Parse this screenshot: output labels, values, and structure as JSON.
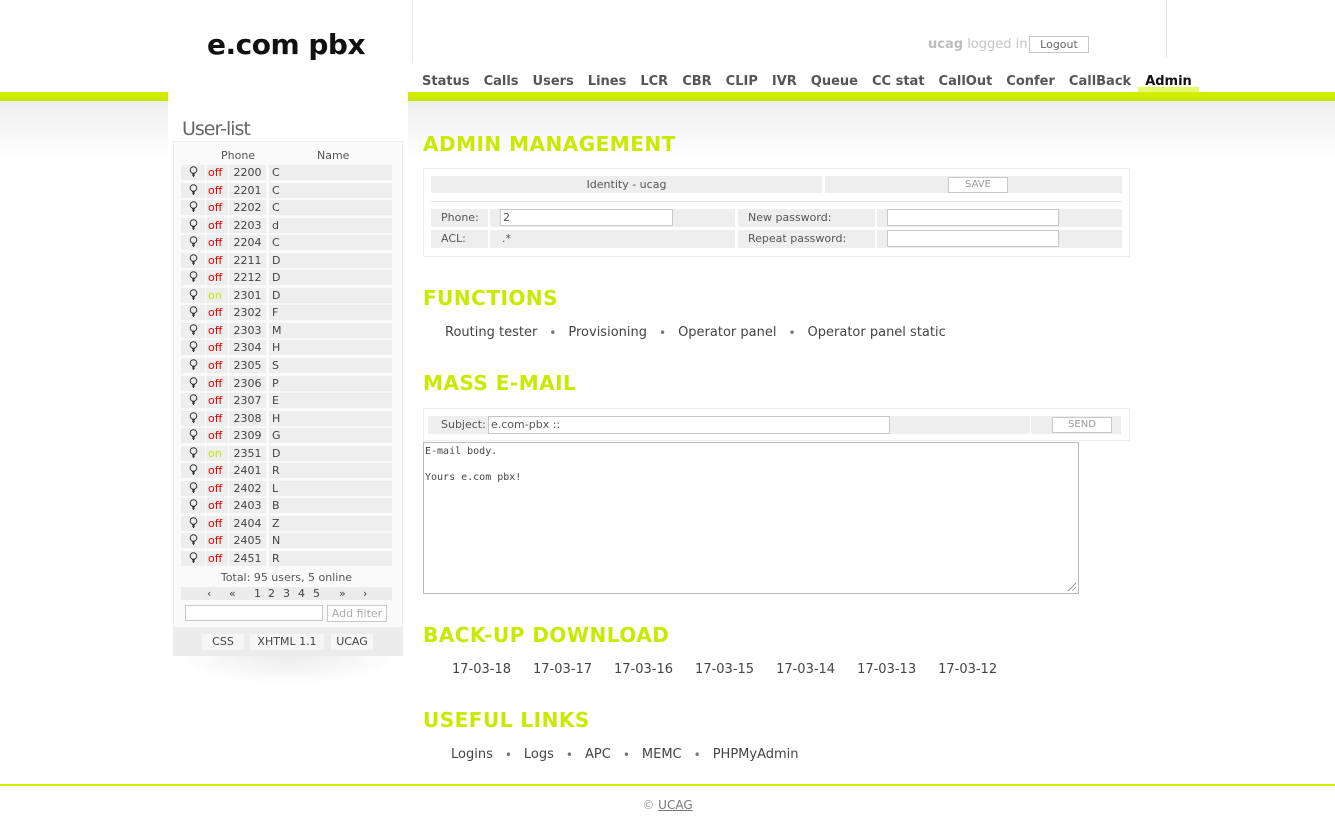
{
  "header": {
    "logo": "e.com pbx",
    "user": "ucag",
    "logged_in_text": "logged in",
    "logout_label": "Logout"
  },
  "nav": {
    "items": [
      "Status",
      "Calls",
      "Users",
      "Lines",
      "LCR",
      "CBR",
      "CLIP",
      "IVR",
      "Queue",
      "CC stat",
      "CallOut",
      "Confer",
      "CallBack",
      "Admin"
    ],
    "active": "Admin"
  },
  "sidebar": {
    "title": "User-list",
    "col_phone": "Phone",
    "col_name": "Name",
    "users": [
      {
        "state": "off",
        "phone": "2200",
        "name": "C"
      },
      {
        "state": "off",
        "phone": "2201",
        "name": "C"
      },
      {
        "state": "off",
        "phone": "2202",
        "name": "C"
      },
      {
        "state": "off",
        "phone": "2203",
        "name": "d"
      },
      {
        "state": "off",
        "phone": "2204",
        "name": "C"
      },
      {
        "state": "off",
        "phone": "2211",
        "name": "D"
      },
      {
        "state": "off",
        "phone": "2212",
        "name": "D"
      },
      {
        "state": "on",
        "phone": "2301",
        "name": "D"
      },
      {
        "state": "off",
        "phone": "2302",
        "name": "F"
      },
      {
        "state": "off",
        "phone": "2303",
        "name": "M"
      },
      {
        "state": "off",
        "phone": "2304",
        "name": "H"
      },
      {
        "state": "off",
        "phone": "2305",
        "name": "S"
      },
      {
        "state": "off",
        "phone": "2306",
        "name": "P"
      },
      {
        "state": "off",
        "phone": "2307",
        "name": "E"
      },
      {
        "state": "off",
        "phone": "2308",
        "name": "H"
      },
      {
        "state": "off",
        "phone": "2309",
        "name": "G"
      },
      {
        "state": "on",
        "phone": "2351",
        "name": "D"
      },
      {
        "state": "off",
        "phone": "2401",
        "name": "R"
      },
      {
        "state": "off",
        "phone": "2402",
        "name": "L"
      },
      {
        "state": "off",
        "phone": "2403",
        "name": "B"
      },
      {
        "state": "off",
        "phone": "2404",
        "name": "Z"
      },
      {
        "state": "off",
        "phone": "2405",
        "name": "N"
      },
      {
        "state": "off",
        "phone": "2451",
        "name": "R"
      }
    ],
    "total": "Total: 95 users, 5 online",
    "pager": {
      "prev": "‹",
      "first": "«",
      "pages": [
        "1",
        "2",
        "3",
        "4",
        "5"
      ],
      "last": "»",
      "next": "›"
    },
    "add_filter_label": "Add filter",
    "badges": [
      "CSS",
      "XHTML 1.1",
      "UCAG"
    ]
  },
  "admin": {
    "title": "ADMIN MANAGEMENT",
    "identity": "Identity - ucag",
    "save_label": "SAVE",
    "phone_label": "Phone:",
    "phone_value": "2",
    "acl_label": "ACL:",
    "acl_value": ".*",
    "new_password_label": "New password:",
    "repeat_password_label": "Repeat password:"
  },
  "functions": {
    "title": "FUNCTIONS",
    "links": [
      "Routing tester",
      "Provisioning",
      "Operator panel",
      "Operator panel static"
    ]
  },
  "mass_email": {
    "title": "MASS E-MAIL",
    "subject_label": "Subject:",
    "subject_value": "e.com-pbx ::",
    "send_label": "SEND",
    "body": "E-mail body.\n\nYours e.com pbx!"
  },
  "backup": {
    "title": "BACK-UP DOWNLOAD",
    "dates": [
      "17-03-18",
      "17-03-17",
      "17-03-16",
      "17-03-15",
      "17-03-14",
      "17-03-13",
      "17-03-12"
    ]
  },
  "useful_links": {
    "title": "USEFUL LINKS",
    "links": [
      "Logins",
      "Logs",
      "APC",
      "MEMC",
      "PHPMyAdmin"
    ]
  },
  "footer": {
    "copyright": "©",
    "link": "UCAG"
  },
  "colors": {
    "accent": "#c7ea00",
    "state_off": "#e00000",
    "state_on": "#c2e600"
  }
}
